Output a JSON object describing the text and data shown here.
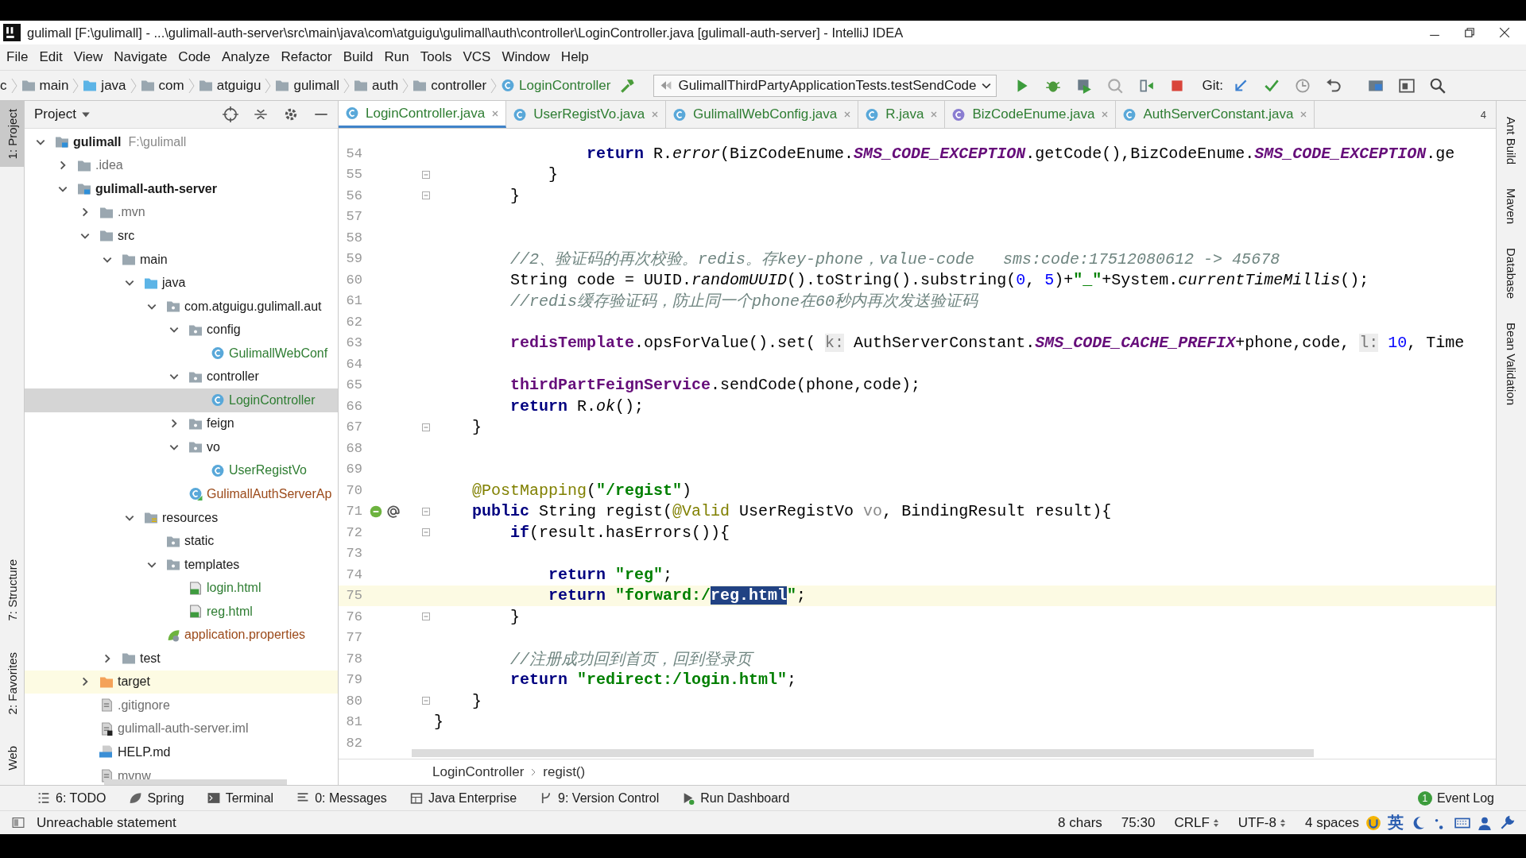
{
  "window": {
    "title": "gulimall [F:\\gulimall] - ...\\gulimall-auth-server\\src\\main\\java\\com\\atguigu\\gulimall\\auth\\controller\\LoginController.java [gulimall-auth-server] - IntelliJ IDEA"
  },
  "menu": [
    "File",
    "Edit",
    "View",
    "Navigate",
    "Code",
    "Analyze",
    "Refactor",
    "Build",
    "Run",
    "Tools",
    "VCS",
    "Window",
    "Help"
  ],
  "nav_bar": {
    "crumbs": [
      {
        "label": "c",
        "kind": "text"
      },
      {
        "label": "main",
        "kind": "folder"
      },
      {
        "label": "java",
        "kind": "source"
      },
      {
        "label": "com",
        "kind": "folder"
      },
      {
        "label": "atguigu",
        "kind": "folder"
      },
      {
        "label": "gulimall",
        "kind": "folder"
      },
      {
        "label": "auth",
        "kind": "folder"
      },
      {
        "label": "controller",
        "kind": "folder"
      },
      {
        "label": "LoginController",
        "kind": "class"
      }
    ],
    "run_config": "GulimallThirdPartyApplicationTests.testSendCode",
    "git_label": "Git:"
  },
  "left_stripe_top": [
    {
      "label": "1: Project",
      "selected": true
    }
  ],
  "left_stripe_bottom": [
    {
      "label": "7: Structure",
      "selected": false
    },
    {
      "label": "2: Favorites",
      "selected": false
    },
    {
      "label": "Web",
      "selected": false
    }
  ],
  "right_stripe": [
    "Ant Build",
    "Maven",
    "Database",
    "Bean Validation"
  ],
  "project": {
    "title": "Project",
    "tree": [
      {
        "name": "gulimall",
        "hint": "F:\\gulimall",
        "kind": "module",
        "expanded": true,
        "selected": false,
        "children": [
          {
            "name": ".idea",
            "kind": "folder",
            "color": "#6e6e6e",
            "expanded": false,
            "selected": false
          },
          {
            "name": "gulimall-auth-server",
            "kind": "module",
            "expanded": true,
            "selected": false,
            "children": [
              {
                "name": ".mvn",
                "kind": "folder",
                "color": "#6e6e6e",
                "expanded": false,
                "selected": false
              },
              {
                "name": "src",
                "kind": "folder",
                "expanded": true,
                "selected": false,
                "children": [
                  {
                    "name": "main",
                    "kind": "folder",
                    "expanded": true,
                    "selected": false,
                    "children": [
                      {
                        "name": "java",
                        "kind": "source",
                        "expanded": true,
                        "selected": false,
                        "children": [
                          {
                            "name": "com.atguigu.gulimall.aut",
                            "kind": "package",
                            "expanded": true,
                            "selected": false,
                            "children": [
                              {
                                "name": "config",
                                "kind": "package",
                                "expanded": true,
                                "selected": false,
                                "children": [
                                  {
                                    "name": "GulimallWebConf",
                                    "kind": "class",
                                    "color": "#2e7d32",
                                    "selected": false
                                  }
                                ]
                              },
                              {
                                "name": "controller",
                                "kind": "package",
                                "expanded": true,
                                "selected": false,
                                "children": [
                                  {
                                    "name": "LoginController",
                                    "kind": "class",
                                    "color": "#2e7d32",
                                    "selected": true
                                  }
                                ]
                              },
                              {
                                "name": "feign",
                                "kind": "package",
                                "expanded": false,
                                "selected": false
                              },
                              {
                                "name": "vo",
                                "kind": "package",
                                "expanded": true,
                                "selected": false,
                                "children": [
                                  {
                                    "name": "UserRegistVo",
                                    "kind": "class",
                                    "color": "#2e7d32",
                                    "selected": false
                                  }
                                ]
                              },
                              {
                                "name": "GulimallAuthServerAp",
                                "kind": "spring-class",
                                "color": "#9b4a1a",
                                "selected": false
                              }
                            ]
                          }
                        ]
                      },
                      {
                        "name": "resources",
                        "kind": "resources",
                        "expanded": true,
                        "selected": false,
                        "children": [
                          {
                            "name": "static",
                            "kind": "package",
                            "selected": false
                          },
                          {
                            "name": "templates",
                            "kind": "package",
                            "expanded": true,
                            "selected": false,
                            "children": [
                              {
                                "name": "login.html",
                                "kind": "html",
                                "color": "#2e7d32",
                                "selected": false
                              },
                              {
                                "name": "reg.html",
                                "kind": "html",
                                "color": "#2e7d32",
                                "selected": false
                              }
                            ]
                          },
                          {
                            "name": "application.properties",
                            "kind": "properties",
                            "color": "#9b4a1a",
                            "selected": false
                          }
                        ]
                      }
                    ]
                  },
                  {
                    "name": "test",
                    "kind": "folder",
                    "expanded": false,
                    "selected": false
                  }
                ]
              },
              {
                "name": "target",
                "kind": "excluded",
                "expanded": false,
                "selected": false
              },
              {
                "name": ".gitignore",
                "kind": "file",
                "color": "#6e6e6e",
                "selected": false
              },
              {
                "name": "gulimall-auth-server.iml",
                "kind": "iml",
                "color": "#6e6e6e",
                "selected": false
              },
              {
                "name": "HELP.md",
                "kind": "md",
                "selected": false
              },
              {
                "name": "mvnw",
                "kind": "file",
                "color": "#6e6e6e",
                "selected": false
              }
            ]
          }
        ]
      }
    ]
  },
  "tabs": [
    {
      "label": "LoginController.java",
      "kind": "class",
      "selected": true
    },
    {
      "label": "UserRegistVo.java",
      "kind": "class",
      "selected": false
    },
    {
      "label": "GulimallWebConfig.java",
      "kind": "class",
      "selected": false
    },
    {
      "label": "R.java",
      "kind": "class",
      "selected": false
    },
    {
      "label": "BizCodeEnume.java",
      "kind": "enum",
      "selected": false
    },
    {
      "label": "AuthServerConstant.java",
      "kind": "class",
      "selected": false
    }
  ],
  "tabs_overflow": "4",
  "code": [
    {
      "number": "54",
      "fold": false,
      "current": false,
      "tokens": [
        {
          "kind": "keyword",
          "text": "                return"
        },
        {
          "kind": "plain",
          "text": " R."
        },
        {
          "kind": "method",
          "text": "error"
        },
        {
          "kind": "plain",
          "text": "(BizCodeEnume."
        },
        {
          "kind": "constant",
          "text": "SMS_CODE_EXCEPTION"
        },
        {
          "kind": "plain",
          "text": ".getCode(),BizCodeEnume."
        },
        {
          "kind": "constant",
          "text": "SMS_CODE_EXCEPTION"
        },
        {
          "kind": "plain",
          "text": ".ge"
        }
      ]
    },
    {
      "number": "55",
      "fold": true,
      "current": false,
      "tokens": [
        {
          "kind": "plain",
          "text": "            }"
        }
      ]
    },
    {
      "number": "56",
      "fold": true,
      "current": false,
      "tokens": [
        {
          "kind": "plain",
          "text": "        }"
        }
      ]
    },
    {
      "number": "57",
      "fold": false,
      "current": false
    },
    {
      "number": "58",
      "fold": false,
      "current": false
    },
    {
      "number": "59",
      "fold": false,
      "current": false,
      "tokens": [
        {
          "kind": "comment",
          "text": "        //2、验证码的再次校验。redis。存key-phone，value-code   sms:code:17512080612 -> 45678"
        }
      ]
    },
    {
      "number": "60",
      "fold": false,
      "current": false,
      "tokens": [
        {
          "kind": "plain",
          "text": "        String code = UUID."
        },
        {
          "kind": "method",
          "text": "randomUUID"
        },
        {
          "kind": "plain",
          "text": "().toString().substring("
        },
        {
          "kind": "number",
          "text": "0"
        },
        {
          "kind": "plain",
          "text": ", "
        },
        {
          "kind": "number",
          "text": "5"
        },
        {
          "kind": "plain",
          "text": ")+"
        },
        {
          "kind": "string",
          "text": "\"_\""
        },
        {
          "kind": "plain",
          "text": "+System."
        },
        {
          "kind": "method",
          "text": "currentTimeMillis"
        },
        {
          "kind": "plain",
          "text": "();"
        }
      ]
    },
    {
      "number": "61",
      "fold": false,
      "current": false,
      "tokens": [
        {
          "kind": "comment",
          "text": "        //redis缓存验证码，防止同一个phone在60秒内再次发送验证码"
        }
      ]
    },
    {
      "number": "62",
      "fold": false,
      "current": false
    },
    {
      "number": "63",
      "fold": false,
      "current": false,
      "tokens": [
        {
          "kind": "field",
          "text": "        redisTemplate"
        },
        {
          "kind": "plain",
          "text": ".opsForValue().set( "
        },
        {
          "kind": "hint",
          "text": "k:"
        },
        {
          "kind": "plain",
          "text": " AuthServerConstant."
        },
        {
          "kind": "constant",
          "text": "SMS_CODE_CACHE_PREFIX"
        },
        {
          "kind": "plain",
          "text": "+phone,code, "
        },
        {
          "kind": "hint",
          "text": "l:"
        },
        {
          "kind": "number",
          "text": " 10"
        },
        {
          "kind": "plain",
          "text": ", Time"
        }
      ]
    },
    {
      "number": "64",
      "fold": false,
      "current": false
    },
    {
      "number": "65",
      "fold": false,
      "current": false,
      "tokens": [
        {
          "kind": "field",
          "text": "        thirdPartFeignService"
        },
        {
          "kind": "plain",
          "text": ".sendCode(phone,code);"
        }
      ]
    },
    {
      "number": "66",
      "fold": false,
      "current": false,
      "tokens": [
        {
          "kind": "keyword",
          "text": "        return"
        },
        {
          "kind": "plain",
          "text": " R."
        },
        {
          "kind": "method",
          "text": "ok"
        },
        {
          "kind": "plain",
          "text": "();"
        }
      ]
    },
    {
      "number": "67",
      "fold": true,
      "current": false,
      "tokens": [
        {
          "kind": "plain",
          "text": "    }"
        }
      ]
    },
    {
      "number": "68",
      "fold": false,
      "current": false
    },
    {
      "number": "69",
      "fold": false,
      "current": false
    },
    {
      "number": "70",
      "fold": false,
      "current": false,
      "tokens": [
        {
          "kind": "annotation",
          "text": "    @PostMapping"
        },
        {
          "kind": "plain",
          "text": "("
        },
        {
          "kind": "string",
          "text": "\"/regist\""
        },
        {
          "kind": "plain",
          "text": ")"
        }
      ]
    },
    {
      "number": "71",
      "fold": true,
      "current": false,
      "endpoint": true,
      "tokens": [
        {
          "kind": "keyword",
          "text": "    public"
        },
        {
          "kind": "plain",
          "text": " String regist("
        },
        {
          "kind": "annotation",
          "text": "@Valid"
        },
        {
          "kind": "plain",
          "text": " UserRegistVo "
        },
        {
          "kind": "unused",
          "text": "vo"
        },
        {
          "kind": "plain",
          "text": ", BindingResult result){"
        }
      ]
    },
    {
      "number": "72",
      "fold": true,
      "current": false,
      "tokens": [
        {
          "kind": "keyword",
          "text": "        if"
        },
        {
          "kind": "plain",
          "text": "(result.hasErrors()){"
        }
      ]
    },
    {
      "number": "73",
      "fold": false,
      "current": false
    },
    {
      "number": "74",
      "fold": false,
      "current": false,
      "tokens": [
        {
          "kind": "keyword",
          "text": "            return "
        },
        {
          "kind": "string",
          "text": "\"reg\""
        },
        {
          "kind": "plain",
          "text": ";"
        }
      ]
    },
    {
      "number": "75",
      "fold": false,
      "current": true,
      "tokens": [
        {
          "kind": "keyword",
          "text": "            return "
        },
        {
          "kind": "string",
          "text": "\"forward:/"
        },
        {
          "kind": "selection",
          "text": "reg.html"
        },
        {
          "kind": "string",
          "text": "\""
        },
        {
          "kind": "plain",
          "text": ";"
        }
      ]
    },
    {
      "number": "76",
      "fold": true,
      "current": false,
      "tokens": [
        {
          "kind": "plain",
          "text": "        }"
        }
      ]
    },
    {
      "number": "77",
      "fold": false,
      "current": false
    },
    {
      "number": "78",
      "fold": false,
      "current": false,
      "tokens": [
        {
          "kind": "comment",
          "text": "        //注册成功回到首页，回到登录页"
        }
      ]
    },
    {
      "number": "79",
      "fold": false,
      "current": false,
      "tokens": [
        {
          "kind": "keyword",
          "text": "        return "
        },
        {
          "kind": "string",
          "text": "\"redirect:/login.html\""
        },
        {
          "kind": "plain",
          "text": ";"
        }
      ]
    },
    {
      "number": "80",
      "fold": true,
      "current": false,
      "tokens": [
        {
          "kind": "plain",
          "text": "    }"
        }
      ]
    },
    {
      "number": "81",
      "fold": false,
      "current": false,
      "tokens": [
        {
          "kind": "plain",
          "text": "}"
        }
      ]
    },
    {
      "number": "82",
      "fold": false,
      "current": false
    }
  ],
  "breadcrumb": [
    "LoginController",
    "regist()"
  ],
  "tool_windows": [
    {
      "label": "6: TODO",
      "kind": "todo"
    },
    {
      "label": "Spring",
      "kind": "spring"
    },
    {
      "label": "Terminal",
      "kind": "terminal"
    },
    {
      "label": "0: Messages",
      "kind": "messages"
    },
    {
      "label": "Java Enterprise",
      "kind": "enterprise"
    },
    {
      "label": "9: Version Control",
      "kind": "vcs"
    },
    {
      "label": "Run Dashboard",
      "kind": "run"
    }
  ],
  "event_log": {
    "label": "Event Log",
    "count": "1"
  },
  "status_bar": {
    "message": "Unreachable statement",
    "items": [
      {
        "label": "8 chars",
        "dropdown": false
      },
      {
        "label": "75:30",
        "dropdown": false
      },
      {
        "label": "CRLF",
        "dropdown": true
      },
      {
        "label": "UTF-8",
        "dropdown": true
      },
      {
        "label": "4 spaces",
        "dropdown": false
      }
    ],
    "ime": "英"
  }
}
